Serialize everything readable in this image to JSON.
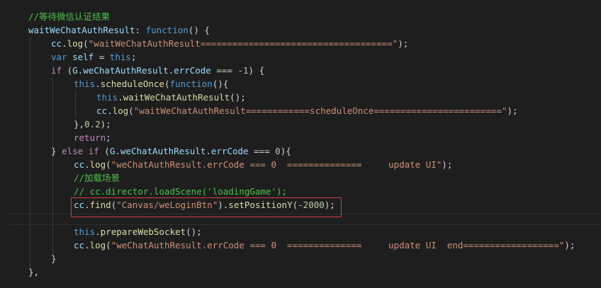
{
  "editor": {
    "lines": [
      {
        "indent": 40,
        "tokens": [
          {
            "t": "//等待微信认证结果",
            "k": "comment"
          }
        ]
      },
      {
        "indent": 40,
        "tokens": [
          {
            "t": "waitWeChatAuthResult",
            "k": "var"
          },
          {
            "t": ": ",
            "k": "plain"
          },
          {
            "t": "function",
            "k": "kw"
          },
          {
            "t": "() {",
            "k": "plain"
          }
        ]
      },
      {
        "indent": 72,
        "tokens": [
          {
            "t": "cc",
            "k": "var"
          },
          {
            "t": ".",
            "k": "plain"
          },
          {
            "t": "log",
            "k": "fn"
          },
          {
            "t": "(",
            "k": "plain"
          },
          {
            "t": "\"waitWeChatAuthResult====================================\"",
            "k": "str"
          },
          {
            "t": ");",
            "k": "plain"
          }
        ]
      },
      {
        "indent": 72,
        "tokens": [
          {
            "t": "var",
            "k": "kw"
          },
          {
            "t": " ",
            "k": "plain"
          },
          {
            "t": "self",
            "k": "var"
          },
          {
            "t": " = ",
            "k": "plain"
          },
          {
            "t": "this",
            "k": "kw"
          },
          {
            "t": ";",
            "k": "plain"
          }
        ]
      },
      {
        "indent": 72,
        "tokens": [
          {
            "t": "if",
            "k": "ctrl"
          },
          {
            "t": " (",
            "k": "plain"
          },
          {
            "t": "G",
            "k": "var"
          },
          {
            "t": ".",
            "k": "plain"
          },
          {
            "t": "weChatAuthResult",
            "k": "var"
          },
          {
            "t": ".",
            "k": "plain"
          },
          {
            "t": "errCode",
            "k": "var"
          },
          {
            "t": " === ",
            "k": "plain"
          },
          {
            "t": "-1",
            "k": "num"
          },
          {
            "t": ") {",
            "k": "plain"
          }
        ]
      },
      {
        "indent": 104,
        "tokens": [
          {
            "t": "this",
            "k": "kw"
          },
          {
            "t": ".",
            "k": "plain"
          },
          {
            "t": "scheduleOnce",
            "k": "fn"
          },
          {
            "t": "(",
            "k": "plain"
          },
          {
            "t": "function",
            "k": "kw"
          },
          {
            "t": "(){",
            "k": "plain"
          }
        ]
      },
      {
        "indent": 136,
        "tokens": [
          {
            "t": "this",
            "k": "kw"
          },
          {
            "t": ".",
            "k": "plain"
          },
          {
            "t": "waitWeChatAuthResult",
            "k": "fn"
          },
          {
            "t": "();",
            "k": "plain"
          }
        ]
      },
      {
        "indent": 136,
        "tokens": [
          {
            "t": "cc",
            "k": "var"
          },
          {
            "t": ".",
            "k": "plain"
          },
          {
            "t": "log",
            "k": "fn"
          },
          {
            "t": "(",
            "k": "plain"
          },
          {
            "t": "\"waitWeChatAuthResult============scheduleOnce========================\"",
            "k": "str"
          },
          {
            "t": ");",
            "k": "plain"
          }
        ]
      },
      {
        "indent": 104,
        "tokens": [
          {
            "t": "},",
            "k": "plain"
          },
          {
            "t": "0.2",
            "k": "num"
          },
          {
            "t": ");",
            "k": "plain"
          }
        ]
      },
      {
        "indent": 104,
        "tokens": [
          {
            "t": "return",
            "k": "ctrl"
          },
          {
            "t": ";",
            "k": "plain"
          }
        ]
      },
      {
        "indent": 72,
        "tokens": [
          {
            "t": "} ",
            "k": "plain"
          },
          {
            "t": "else",
            "k": "ctrl"
          },
          {
            "t": " ",
            "k": "plain"
          },
          {
            "t": "if",
            "k": "ctrl"
          },
          {
            "t": " (",
            "k": "plain"
          },
          {
            "t": "G",
            "k": "var"
          },
          {
            "t": ".",
            "k": "plain"
          },
          {
            "t": "weChatAuthResult",
            "k": "var"
          },
          {
            "t": ".",
            "k": "plain"
          },
          {
            "t": "errCode",
            "k": "var"
          },
          {
            "t": " === ",
            "k": "plain"
          },
          {
            "t": "0",
            "k": "num"
          },
          {
            "t": "){",
            "k": "plain"
          }
        ]
      },
      {
        "indent": 104,
        "tokens": [
          {
            "t": "cc",
            "k": "var"
          },
          {
            "t": ".",
            "k": "plain"
          },
          {
            "t": "log",
            "k": "fn"
          },
          {
            "t": "(",
            "k": "plain"
          },
          {
            "t": "\"weChatAuthResult.errCode === 0  ==============     update UI\"",
            "k": "str"
          },
          {
            "t": ");",
            "k": "plain"
          }
        ]
      },
      {
        "indent": 104,
        "tokens": [
          {
            "t": "//加载场景",
            "k": "comment"
          }
        ]
      },
      {
        "indent": 104,
        "tokens": [
          {
            "t": "// cc.director.loadScene('loadingGame');",
            "k": "comment"
          }
        ]
      },
      {
        "indent": 104,
        "tokens": [
          {
            "t": "cc",
            "k": "var"
          },
          {
            "t": ".",
            "k": "plain"
          },
          {
            "t": "find",
            "k": "fn"
          },
          {
            "t": "(",
            "k": "plain"
          },
          {
            "t": "\"Canvas/weLoginBtn\"",
            "k": "str"
          },
          {
            "t": ").",
            "k": "plain"
          },
          {
            "t": "setPositionY",
            "k": "fn"
          },
          {
            "t": "(",
            "k": "plain"
          },
          {
            "t": "-2000",
            "k": "num"
          },
          {
            "t": ");",
            "k": "plain"
          }
        ]
      },
      {
        "indent": 104,
        "tokens": []
      },
      {
        "indent": 104,
        "tokens": [
          {
            "t": "this",
            "k": "kw"
          },
          {
            "t": ".",
            "k": "plain"
          },
          {
            "t": "prepareWebSocket",
            "k": "fn"
          },
          {
            "t": "();",
            "k": "plain"
          }
        ]
      },
      {
        "indent": 104,
        "tokens": [
          {
            "t": "cc",
            "k": "var"
          },
          {
            "t": ".",
            "k": "plain"
          },
          {
            "t": "log",
            "k": "fn"
          },
          {
            "t": "(",
            "k": "plain"
          },
          {
            "t": "\"weChatAuthResult.errCode === 0  ==============     update UI  end==================\"",
            "k": "str"
          },
          {
            "t": ");",
            "k": "plain"
          }
        ]
      },
      {
        "indent": 72,
        "tokens": [
          {
            "t": "}",
            "k": "plain"
          }
        ]
      },
      {
        "indent": 40,
        "tokens": [
          {
            "t": "},",
            "k": "plain"
          }
        ]
      }
    ]
  },
  "colors": {
    "background": "#1e1e1e",
    "comment": "#4ec04a",
    "keyword": "#569cd6",
    "control": "#c586c0",
    "string": "#ce9178",
    "number": "#b5cea8",
    "function": "#dcdcaa",
    "variable": "#9cdcfe",
    "highlight_border": "#d43c3c"
  }
}
